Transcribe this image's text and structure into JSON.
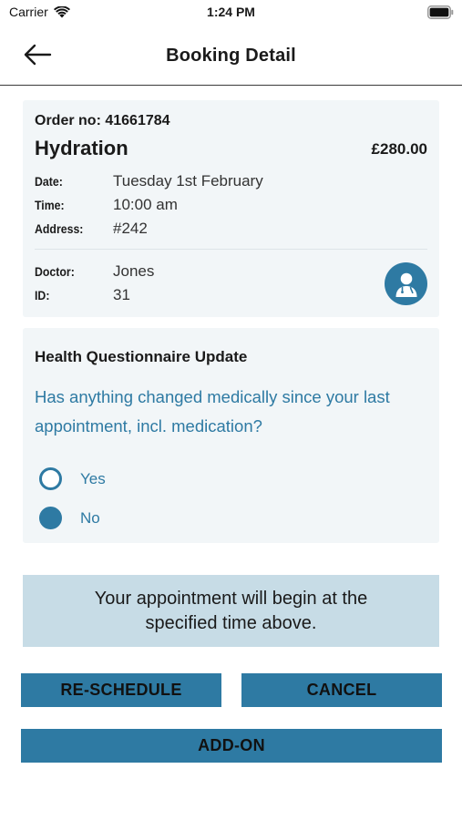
{
  "status_bar": {
    "carrier": "Carrier",
    "time": "1:24 PM"
  },
  "header": {
    "title": "Booking Detail"
  },
  "booking": {
    "order_label": "Order no:",
    "order_number": "41661784",
    "service": "Hydration",
    "price": "£280.00",
    "date_label": "Date:",
    "date_value": "Tuesday 1st February",
    "time_label": "Time:",
    "time_value": "10:00 am",
    "address_label": "Address:",
    "address_value": "#242",
    "doctor_label": "Doctor:",
    "doctor_value": "Jones",
    "id_label": "ID:",
    "id_value": "31"
  },
  "questionnaire": {
    "title": "Health Questionnaire Update",
    "question": "Has anything changed medically since your last appointment, incl. medication?",
    "options": [
      {
        "label": "Yes",
        "selected": false
      },
      {
        "label": "No",
        "selected": true
      }
    ]
  },
  "notice": "Your appointment will begin at the specified time above.",
  "actions": {
    "reschedule_label": "RE-SCHEDULE",
    "cancel_label": "CANCEL",
    "addon_label": "ADD-ON"
  },
  "colors": {
    "accent": "#2e7aa3",
    "card_bg": "#f2f6f8",
    "notice_bg": "#c7dce6"
  }
}
